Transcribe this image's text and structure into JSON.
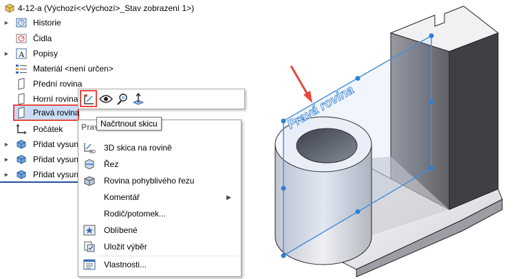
{
  "tree": {
    "root_label": "4-12-a  (Výchozí<<Výchozí>_Stav zobrazení 1>)",
    "items": [
      {
        "label": "Historie",
        "icon": "history-folder-icon"
      },
      {
        "label": "Čidla",
        "icon": "sensors-icon"
      },
      {
        "label": "Popisy",
        "icon": "annotations-icon"
      },
      {
        "label": "Materiál <není určen>",
        "icon": "material-icon"
      },
      {
        "label": "Přední rovina",
        "icon": "plane-icon"
      },
      {
        "label": "Horní rovina",
        "icon": "plane-icon"
      },
      {
        "label": "Pravá rovina",
        "icon": "plane-icon"
      },
      {
        "label": "Počátek",
        "icon": "origin-icon"
      },
      {
        "label": "Přidat vysun",
        "icon": "extrude-feature-icon"
      },
      {
        "label": "Přidat vysun",
        "icon": "extrude-feature-icon"
      },
      {
        "label": "Přidat vysun",
        "icon": "extrude-feature-icon"
      }
    ]
  },
  "toolbar": {
    "icons": [
      "sketch-icon",
      "show-hide-eye-icon",
      "zoom-to-selection-icon",
      "normal-to-icon"
    ]
  },
  "tooltip": {
    "text": "Načrtnout skicu"
  },
  "context_menu": {
    "header": "Pravá rovina",
    "items": [
      {
        "label": "3D skica na rovině",
        "icon": "3d-sketch-icon"
      },
      {
        "label": "Řez",
        "icon": "section-view-icon"
      },
      {
        "label": "Rovina pohyblivého řezu",
        "icon": "moving-section-plane-icon"
      },
      {
        "label": "Komentář",
        "icon": "",
        "submenu": "▶"
      },
      {
        "label": "Rodič/potomek...",
        "icon": ""
      },
      {
        "label": "Oblíbené",
        "icon": "favorites-star-icon"
      },
      {
        "label": "Uložit výběr",
        "icon": "save-selection-icon"
      },
      {
        "label": "Vlastnosti...",
        "icon": "properties-icon"
      }
    ]
  },
  "viewport": {
    "plane_label": "Pravá rovina",
    "colors": {
      "plane": "#4a8fd8",
      "highlight": "#e8463a",
      "selection": "#c9dcf5"
    }
  }
}
